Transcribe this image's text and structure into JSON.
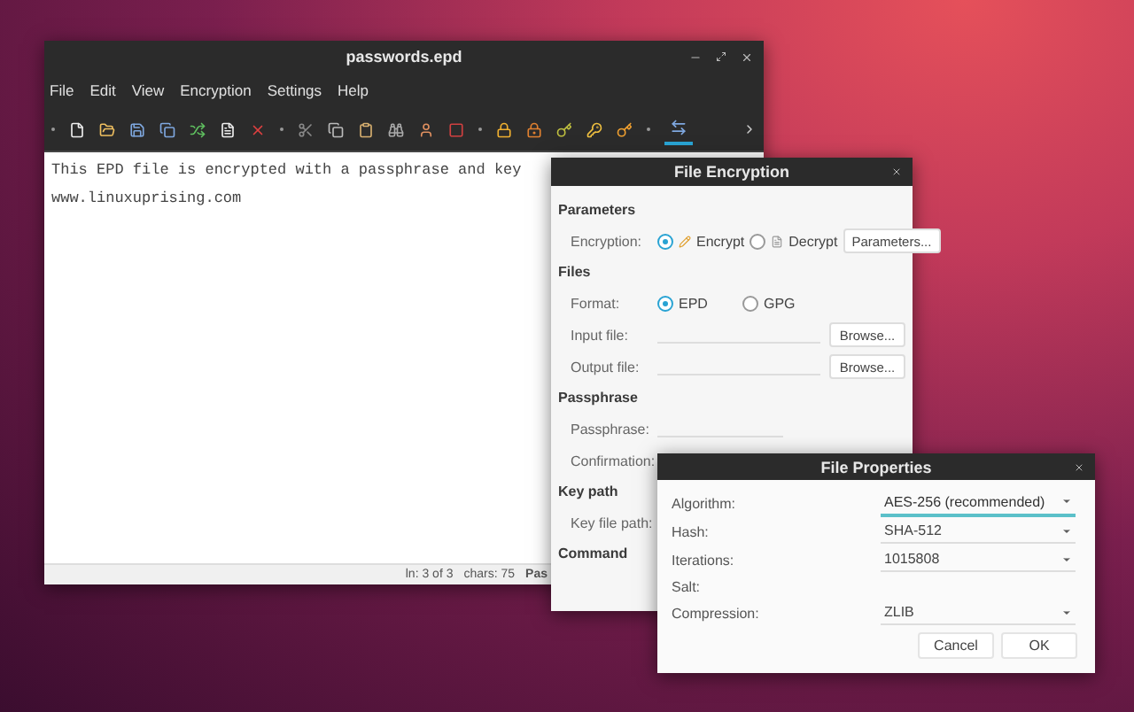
{
  "editor": {
    "title": "passwords.epd",
    "menu": [
      "File",
      "Edit",
      "View",
      "Encryption",
      "Settings",
      "Help"
    ],
    "toolbar": {
      "last_toggle_on": true
    },
    "text_lines": [
      "This EPD file is encrypted with a passphrase and key",
      "www.linuxuprising.com"
    ],
    "status": [
      "ln: 3 of 3",
      "chars: 75",
      "Pas"
    ]
  },
  "encryption_dialog": {
    "title": "File Encryption",
    "parameters_heading": "Parameters",
    "encryption_label": "Encryption:",
    "modes": [
      {
        "label": "Encrypt",
        "selected": true
      },
      {
        "label": "Decrypt",
        "selected": false
      }
    ],
    "parameters_button": "Parameters...",
    "files_heading": "Files",
    "format_label": "Format:",
    "formats": [
      {
        "label": "EPD",
        "selected": true
      },
      {
        "label": "GPG",
        "selected": false
      }
    ],
    "file_rows": [
      {
        "label": "Input file:",
        "button": "Browse..."
      },
      {
        "label": "Output file:",
        "button": "Browse..."
      }
    ],
    "passphrase_heading": "Passphrase",
    "passphrase_label": "Passphrase:",
    "confirmation_label": "Confirmation:",
    "key_path_heading": "Key path",
    "key_file_label": "Key file path:",
    "command_heading": "Command"
  },
  "properties_dialog": {
    "title": "File Properties",
    "rows": [
      {
        "kind": "select",
        "label": "Algorithm:",
        "value": "AES-256 (recommended)",
        "focused": true
      },
      {
        "kind": "select",
        "label": "Hash:",
        "value": "SHA-512",
        "focused": false
      },
      {
        "kind": "select",
        "label": "Iterations:",
        "value": "1015808",
        "focused": false
      },
      {
        "kind": "text",
        "label": "Salt:"
      },
      {
        "kind": "select",
        "label": "Compression:",
        "value": "ZLIB",
        "focused": false
      }
    ],
    "buttons": [
      "Cancel",
      "OK"
    ]
  }
}
